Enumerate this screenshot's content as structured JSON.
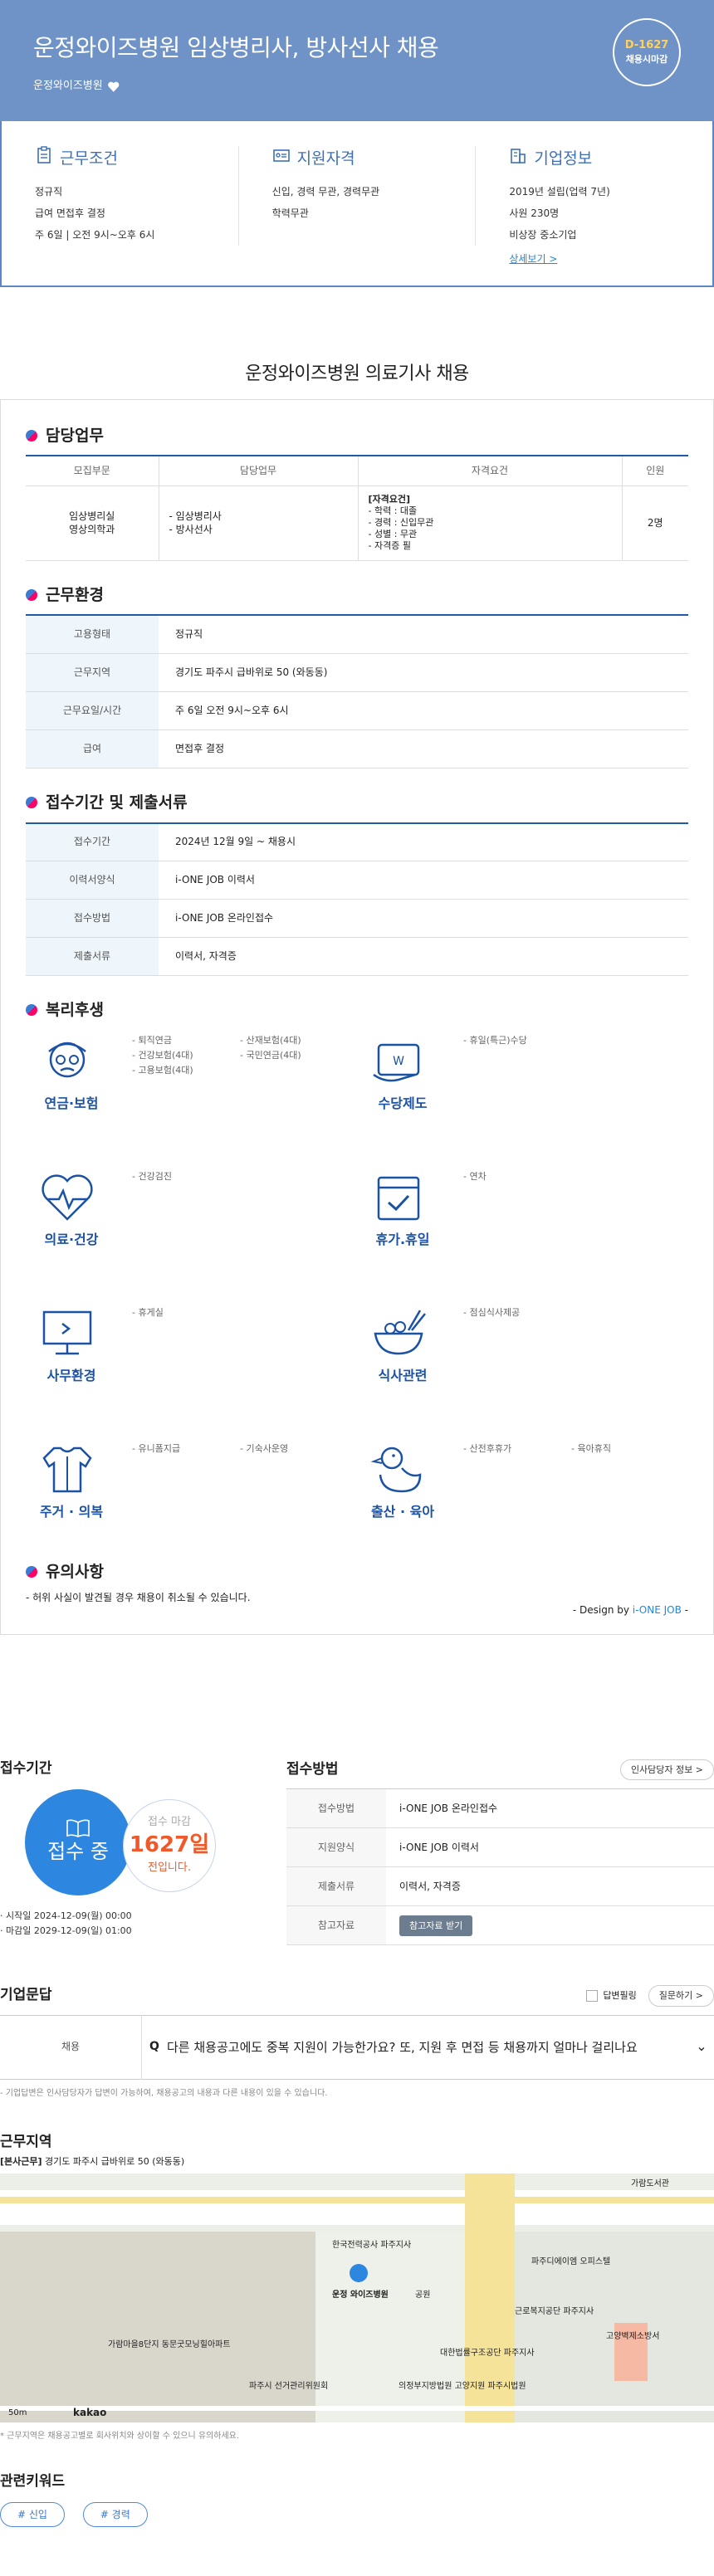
{
  "header": {
    "title": "운정와이즈병원 임상병리사, 방사선사 채용",
    "company": "운정와이즈병원",
    "dday": "D-1627",
    "dday_status": "채용시마감"
  },
  "summary": {
    "conditions": {
      "title": "근무조건",
      "lines": [
        "정규직",
        "급여 면접후 결정",
        "주 6일 | 오전 9시~오후 6시"
      ]
    },
    "qualification": {
      "title": "지원자격",
      "lines": [
        "신입, 경력 무관, 경력무관",
        "학력무관"
      ]
    },
    "company_info": {
      "title": "기업정보",
      "lines": [
        "2019년 설립(업력 7년)",
        "사원 230명",
        "비상장 중소기업"
      ],
      "more": "상세보기 >"
    }
  },
  "main_title": "운정와이즈병원 의료기사 채용",
  "duties": {
    "title": "담당업무",
    "headers": [
      "모집부문",
      "담당업무",
      "자격요건",
      "인원"
    ],
    "dept": [
      "임상병리실",
      "영상의학과"
    ],
    "tasks": [
      "- 임상병리사",
      "- 방사선사"
    ],
    "req": [
      "[자격요건]",
      "- 학력 : 대졸",
      "- 경력 : 신입무관",
      "- 성별 : 무관",
      "- 자격증 필"
    ],
    "count": "2명"
  },
  "env": {
    "title": "근무환경",
    "rows": [
      {
        "k": "고용형태",
        "v": "정규직"
      },
      {
        "k": "근무지역",
        "v": "경기도 파주시 급바위로 50 (와동동)"
      },
      {
        "k": "근무요일/시간",
        "v": "주 6일 오전 9시~오후 6시"
      },
      {
        "k": "급여",
        "v": "면접후 결정"
      }
    ]
  },
  "apply": {
    "title": "접수기간 및 제출서류",
    "rows": [
      {
        "k": "접수기간",
        "v": "2024년 12월 9일 ~ 채용시"
      },
      {
        "k": "이력서양식",
        "v": "i-ONE JOB 이력서"
      },
      {
        "k": "접수방법",
        "v": "i-ONE JOB 온라인접수"
      },
      {
        "k": "제출서류",
        "v": "이력서, 자격증"
      }
    ]
  },
  "benefits": {
    "title": "복리후생",
    "items": [
      {
        "name": "연금·보험",
        "icon": "pension-icon",
        "list": [
          "- 퇴직연금",
          "- 산재보험(4대)",
          "- 건강보험(4대)",
          "- 국민연금(4대)",
          "- 고용보험(4대)"
        ]
      },
      {
        "name": "수당제도",
        "icon": "allowance-icon",
        "list": [
          "- 휴일(특근)수당"
        ]
      },
      {
        "name": "의료·건강",
        "icon": "health-icon",
        "list": [
          "- 건강검진"
        ]
      },
      {
        "name": "휴가.휴일",
        "icon": "calendar-icon",
        "list": [
          "- 연차"
        ]
      },
      {
        "name": "사무환경",
        "icon": "monitor-icon",
        "list": [
          "- 휴게실"
        ]
      },
      {
        "name": "식사관련",
        "icon": "meal-icon",
        "list": [
          "- 점심식사제공"
        ]
      },
      {
        "name": "주거 · 의복",
        "icon": "clothing-icon",
        "list": [
          "- 유니폼지급",
          "- 기숙사운영"
        ]
      },
      {
        "name": "출산 · 육아",
        "icon": "duck-icon",
        "list": [
          "- 산전후휴가",
          "- 육아휴직"
        ]
      }
    ]
  },
  "caution": {
    "title": "유의사항",
    "text": "- 허위 사실이 발견될 경우 채용이 취소될 수 있습니다.",
    "design_prefix": "- Design by ",
    "design_brand": "i-ONE JOB",
    "design_suffix": " -"
  },
  "period": {
    "title": "접수기간",
    "status": "접수 중",
    "deadline_label": "접수 마감",
    "days": "1627일",
    "left": "전입니다.",
    "start": "· 시작일 2024-12-09(월) 00:00",
    "end": "· 마감일 2029-12-09(일) 01:00"
  },
  "method": {
    "title": "접수방법",
    "contact_btn": "인사담당자 정보 >",
    "rows": [
      {
        "k": "접수방법",
        "v": "i-ONE JOB 온라인접수"
      },
      {
        "k": "지원양식",
        "v": "i-ONE JOB 이력서"
      },
      {
        "k": "제출서류",
        "v": "이력서, 자격증"
      },
      {
        "k": "참고자료",
        "v": "참고자료 받기"
      }
    ]
  },
  "qna": {
    "title": "기업문답",
    "filter": "답변필링",
    "ask_btn": "질문하기 >",
    "category": "채용",
    "q": "Q",
    "question": "다른 채용공고에도 중복 지원이 가능한가요? 또, 지원 후 면접 등 채용까지 얼마나 걸리나요",
    "note": "- 기업답변은 인사담당자가 답변이 가능하여, 채용공고의 내용과 다른 내용이 있을 수 있습니다."
  },
  "location": {
    "title": "근무지역",
    "address_tag": "[본사근무]",
    "address": "경기도 파주시 급바위로 50 (와동동)",
    "map_labels": [
      "한국전력공사 파주지사",
      "운정 와이즈병원",
      "파주디에이엠 오피스텔",
      "가람마을8단지 동문굿모닝힐아파트",
      "근로복지공단 파주지사",
      "대한법률구조공단 파주지사",
      "의정부지방법원 고양지원 파주시법원",
      "파주시 선거관리위원회",
      "고양벽제소방서",
      "공원",
      "가람도서관"
    ],
    "scale": "50m",
    "map_brand": "kakao",
    "note": "* 근무지역은 채용공고별로 회사위치와 상이할 수 있으니 유의하세요."
  },
  "keywords": {
    "title": "관련키워드",
    "items": [
      "# 신입",
      "# 경력"
    ]
  }
}
